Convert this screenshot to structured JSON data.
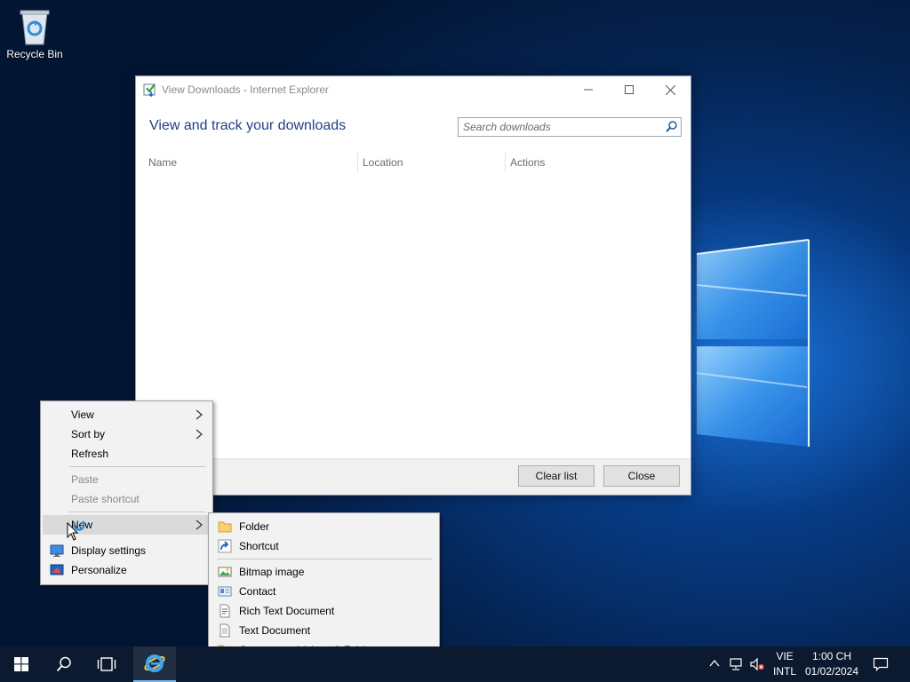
{
  "desktop": {
    "icons": [
      {
        "label": "Recycle Bin",
        "icon": "recycle-bin-icon"
      }
    ]
  },
  "window": {
    "title": "View Downloads - Internet Explorer",
    "heading": "View and track your downloads",
    "search": {
      "placeholder": "Search downloads",
      "value": ""
    },
    "columns": [
      "Name",
      "Location",
      "Actions"
    ],
    "buttons": {
      "clear_list": "Clear list",
      "close": "Close"
    }
  },
  "context_menu": {
    "items": [
      {
        "label": "View",
        "submenu": true,
        "enabled": true
      },
      {
        "label": "Sort by",
        "submenu": true,
        "enabled": true
      },
      {
        "label": "Refresh",
        "enabled": true
      },
      {
        "label": "Paste",
        "enabled": false
      },
      {
        "label": "Paste shortcut",
        "enabled": false
      },
      {
        "label": "New",
        "submenu": true,
        "enabled": true,
        "highlighted": true
      },
      {
        "label": "Display settings",
        "enabled": true,
        "icon": "display-settings-icon"
      },
      {
        "label": "Personalize",
        "enabled": true,
        "icon": "personalize-icon"
      }
    ]
  },
  "new_submenu": {
    "items": [
      {
        "label": "Folder",
        "icon": "folder-icon"
      },
      {
        "label": "Shortcut",
        "icon": "shortcut-icon"
      },
      {
        "label": "Bitmap image",
        "icon": "bitmap-image-icon"
      },
      {
        "label": "Contact",
        "icon": "contact-icon"
      },
      {
        "label": "Rich Text Document",
        "icon": "rich-text-document-icon"
      },
      {
        "label": "Text Document",
        "icon": "text-document-icon"
      },
      {
        "label": "Compressed (zipped) Folder",
        "icon": "zipped-folder-icon"
      }
    ]
  },
  "taskbar": {
    "pinned": [
      "start-icon",
      "search-icon",
      "task-view-icon",
      "internet-explorer-icon"
    ],
    "tray": {
      "language_top": "VIE",
      "language_bottom": "INTL",
      "time": "1:00 CH",
      "date": "01/02/2024"
    }
  },
  "colors": {
    "accent": "#1e3f8c",
    "taskbar": "#0b1a2e",
    "highlight": "#dadada"
  }
}
